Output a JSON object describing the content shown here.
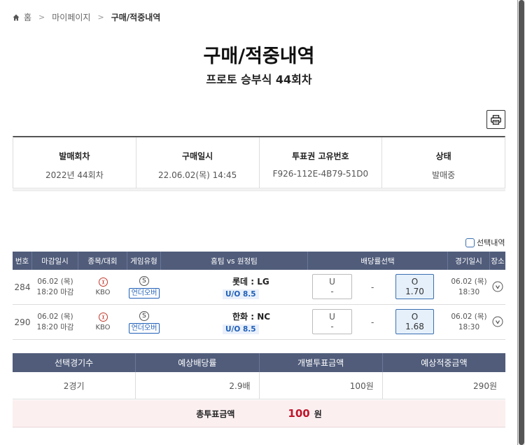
{
  "breadcrumb": {
    "home": "홈",
    "parent": "마이페이지",
    "current": "구매/적중내역"
  },
  "title": "구매/적중내역",
  "subtitle": "프로토 승부식 44회차",
  "info": [
    {
      "label": "발매회차",
      "value": "2022년 44회차"
    },
    {
      "label": "구매일시",
      "value": "22.06.02(목) 14:45"
    },
    {
      "label": "투표권 고유번호",
      "value": "F926-112E-4B79-51D0"
    },
    {
      "label": "상태",
      "value": "발매중"
    }
  ],
  "select_toggle_label": "선택내역",
  "game_headers": [
    "번호",
    "마감일시",
    "종목/대회",
    "게임유형",
    "홈팀 vs 원정팀",
    "배당률선택",
    "경기일시",
    "장소"
  ],
  "games": [
    {
      "no": "284",
      "deadline_date": "06.02 (목)",
      "deadline_time": "18:20 마감",
      "league": "KBO",
      "type_icon": "S",
      "type_label": "언더오버",
      "teams": "롯데 : LG",
      "uo_line": "U/O 8.5",
      "under_label": "U",
      "under_odds": "-",
      "mid": "-",
      "over_label": "O",
      "over_odds": "1.70",
      "game_date": "06.02 (목)",
      "game_time": "18:30"
    },
    {
      "no": "290",
      "deadline_date": "06.02 (목)",
      "deadline_time": "18:20 마감",
      "league": "KBO",
      "type_icon": "S",
      "type_label": "언더오버",
      "teams": "한화 : NC",
      "uo_line": "U/O 8.5",
      "under_label": "U",
      "under_odds": "-",
      "mid": "-",
      "over_label": "O",
      "over_odds": "1.68",
      "game_date": "06.02 (목)",
      "game_time": "18:30"
    }
  ],
  "summary_headers": [
    "선택경기수",
    "예상배당률",
    "개별투표금액",
    "예상적중금액"
  ],
  "summary_values": [
    "2경기",
    "2.9배",
    "100원",
    "290원"
  ],
  "total": {
    "label": "총투표금액",
    "amount": "100",
    "unit": "원"
  },
  "colors": {
    "header_bg": "#505c7a",
    "accent_blue": "#1f5fb8",
    "total_red": "#c0152a",
    "total_bg": "#fbeff0"
  }
}
